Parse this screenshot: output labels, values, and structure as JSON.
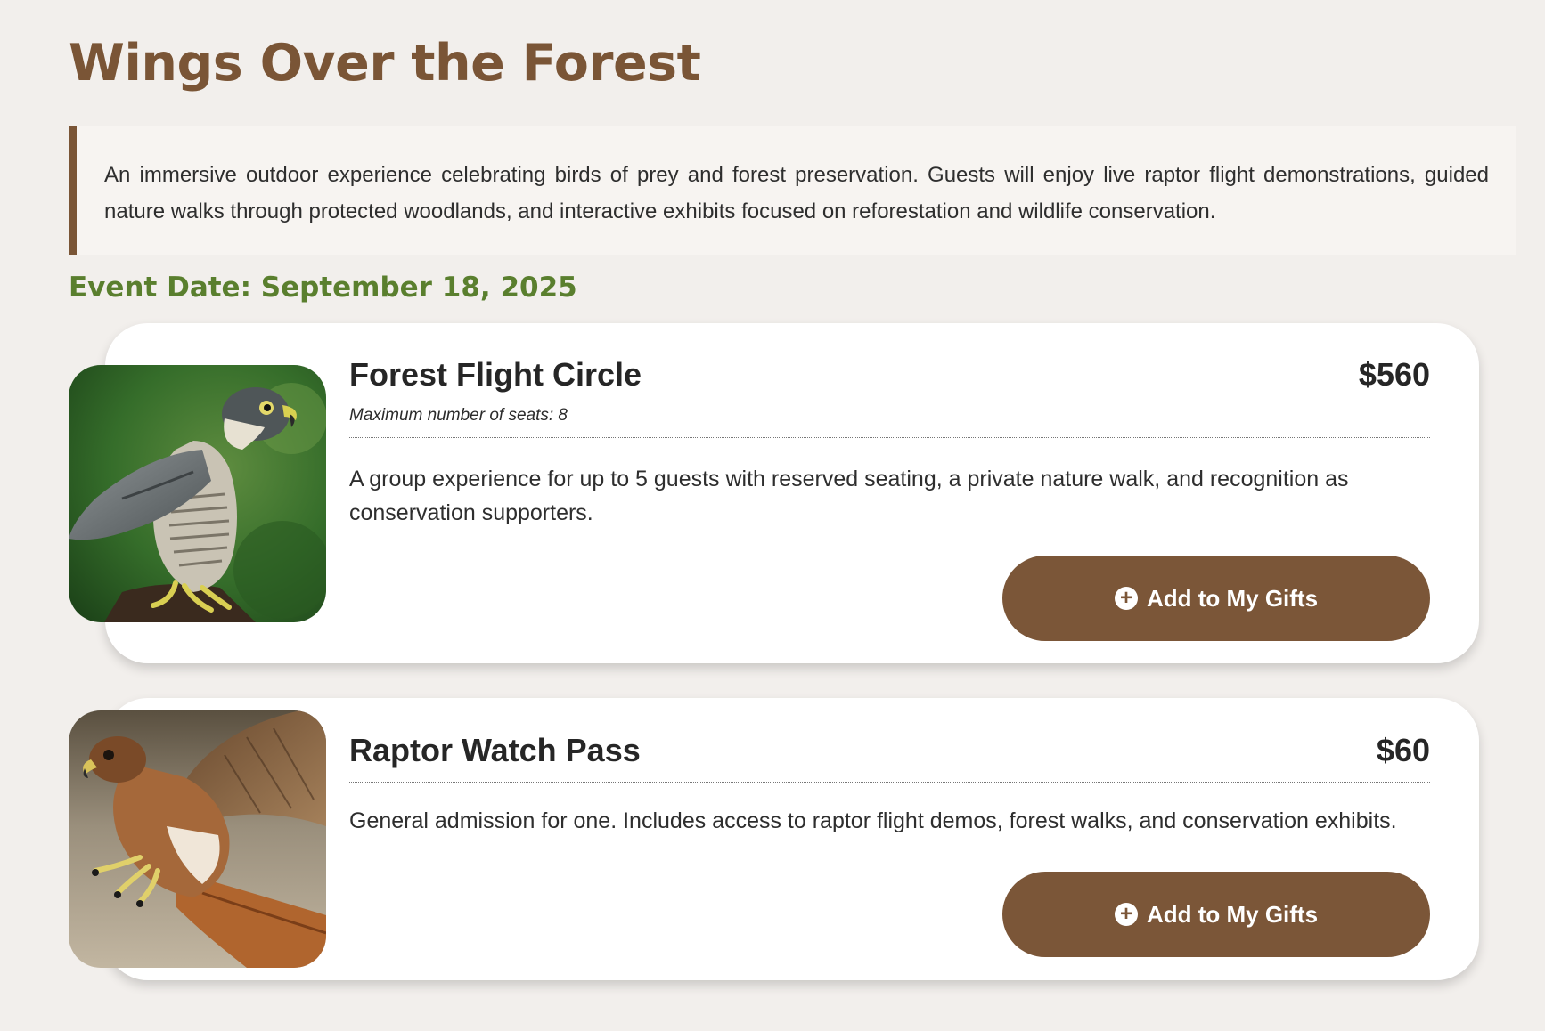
{
  "page": {
    "title": "Wings Over the Forest",
    "intro": "An immersive outdoor experience celebrating birds of prey and forest preservation. Guests will enjoy live raptor flight demonstrations, guided nature walks through protected woodlands, and interactive exhibits focused on reforestation and wildlife conservation.",
    "event_date": "Event Date: September 18, 2025"
  },
  "colors": {
    "background": "#f2efec",
    "brand_brown": "#7b5638",
    "accent_green": "#5a7f2e",
    "card_bg": "#ffffff"
  },
  "packages": [
    {
      "title": "Forest Flight Circle",
      "price": "$560",
      "seats": "Maximum number of seats: 8",
      "description": "A group experience for up to 5 guests with reserved seating, a private nature walk, and recognition as conservation supporters.",
      "button_label": "Add to My Gifts",
      "button_icon": "plus-circle-icon",
      "image": "peregrine-falcon-photo"
    },
    {
      "title": "Raptor Watch Pass",
      "price": "$60",
      "description": "General admission for one. Includes access to raptor flight demos, forest walks, and conservation exhibits.",
      "button_label": "Add to My Gifts",
      "button_icon": "plus-circle-icon",
      "image": "red-tailed-hawk-photo"
    }
  ]
}
